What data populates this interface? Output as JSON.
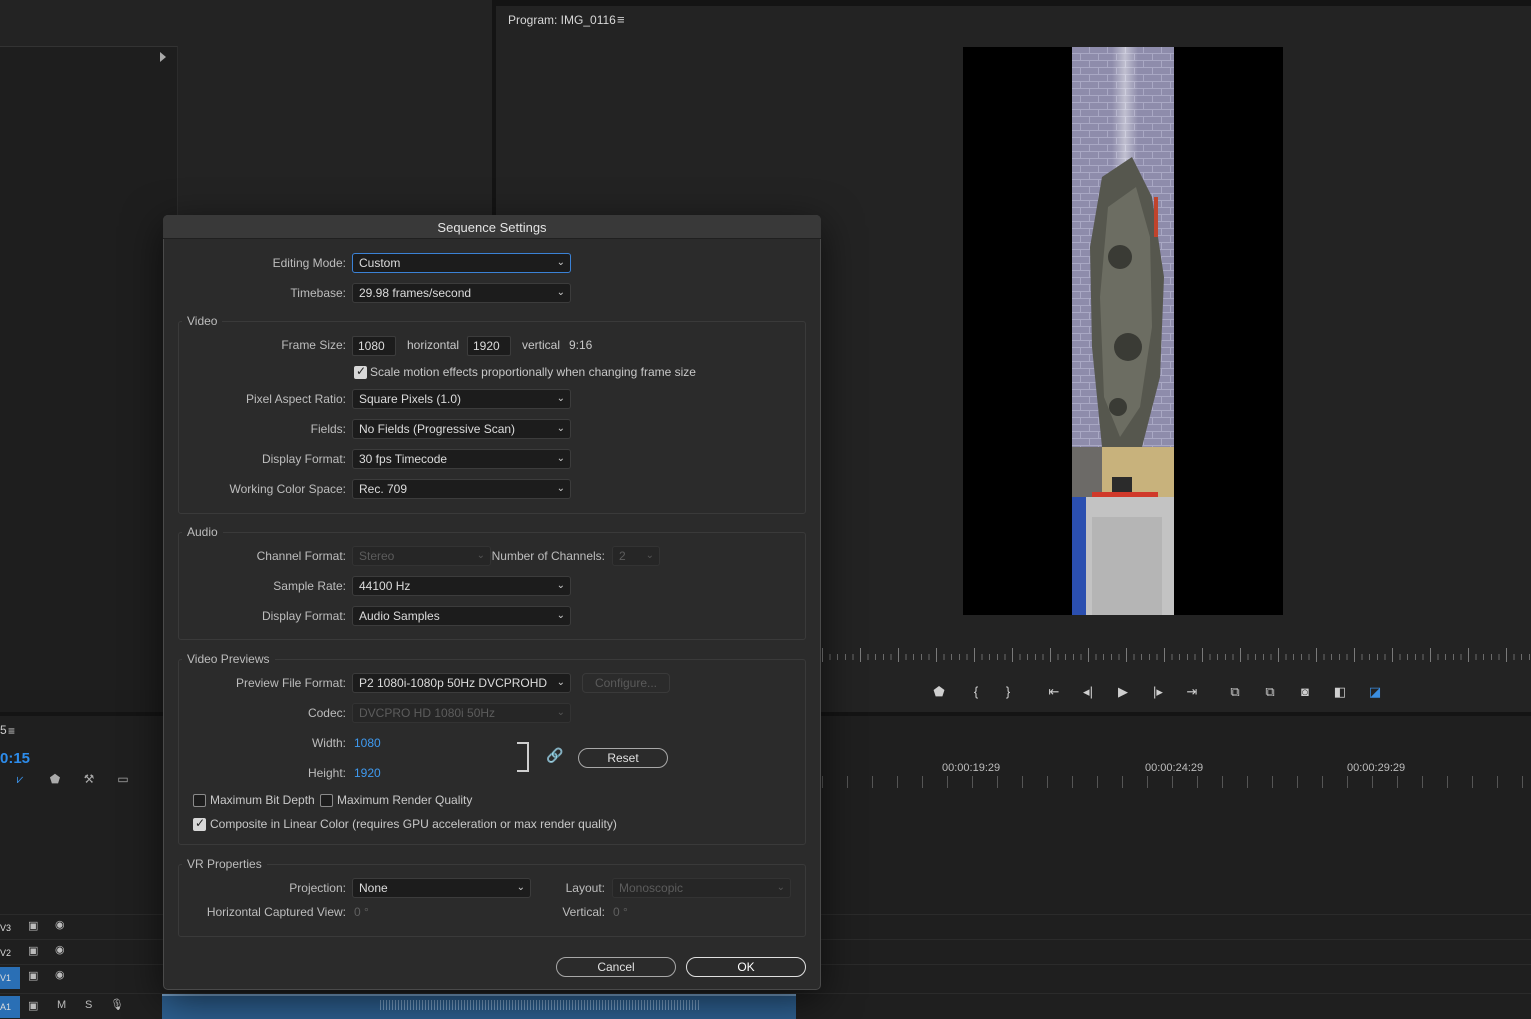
{
  "app": {
    "program_title": "Program: IMG_0116",
    "menu_glyph": "≡",
    "timecode": "0:15",
    "timeline_tab_char": "5",
    "ruler_labels": [
      "00:00:19:29",
      "00:00:24:29",
      "00:00:29:29"
    ],
    "tracks": [
      {
        "label": "V3"
      },
      {
        "label": "V2"
      },
      {
        "label": "V1"
      },
      {
        "label": "A1",
        "m": "M",
        "s": "S"
      }
    ]
  },
  "dialog": {
    "title": "Sequence Settings",
    "editing_mode": {
      "label": "Editing Mode:",
      "value": "Custom"
    },
    "timebase": {
      "label": "Timebase:",
      "value": "29.98  frames/second"
    },
    "video": {
      "title": "Video",
      "frame_size_label": "Frame Size:",
      "width": "1080",
      "horizontal_label": "horizontal",
      "height": "1920",
      "vertical_label": "vertical",
      "aspect": "9:16",
      "scale_checkbox": "Scale motion effects proportionally when changing frame size",
      "pixel_aspect": {
        "label": "Pixel Aspect Ratio:",
        "value": "Square Pixels (1.0)"
      },
      "fields": {
        "label": "Fields:",
        "value": "No Fields (Progressive Scan)"
      },
      "display_format": {
        "label": "Display Format:",
        "value": "30 fps Timecode"
      },
      "color_space": {
        "label": "Working Color Space:",
        "value": "Rec. 709"
      }
    },
    "audio": {
      "title": "Audio",
      "channel_format": {
        "label": "Channel Format:",
        "value": "Stereo"
      },
      "num_channels": {
        "label": "Number of Channels:",
        "value": "2"
      },
      "sample_rate": {
        "label": "Sample Rate:",
        "value": "44100 Hz"
      },
      "display_format": {
        "label": "Display Format:",
        "value": "Audio Samples"
      }
    },
    "previews": {
      "title": "Video Previews",
      "file_format": {
        "label": "Preview File Format:",
        "value": "P2 1080i-1080p 50Hz DVCPROHD"
      },
      "configure": "Configure...",
      "codec": {
        "label": "Codec:",
        "value": "DVCPRO HD 1080i 50Hz"
      },
      "width": {
        "label": "Width:",
        "value": "1080"
      },
      "height": {
        "label": "Height:",
        "value": "1920"
      },
      "reset": "Reset",
      "max_bit_depth": "Maximum Bit Depth",
      "max_render_quality": "Maximum Render Quality",
      "linear_color": "Composite in Linear Color (requires GPU acceleration or max render quality)"
    },
    "vr": {
      "title": "VR Properties",
      "projection": {
        "label": "Projection:",
        "value": "None"
      },
      "layout": {
        "label": "Layout:",
        "value": "Monoscopic"
      },
      "h_view": {
        "label": "Horizontal Captured View:",
        "value": "0 °"
      },
      "vertical": {
        "label": "Vertical:",
        "value": "0 °"
      }
    },
    "cancel": "Cancel",
    "ok": "OK"
  },
  "colors": {
    "accent_blue": "#2d8ceb",
    "focus_blue": "#3b82d6",
    "clip_blue": "#2d5f8f"
  }
}
